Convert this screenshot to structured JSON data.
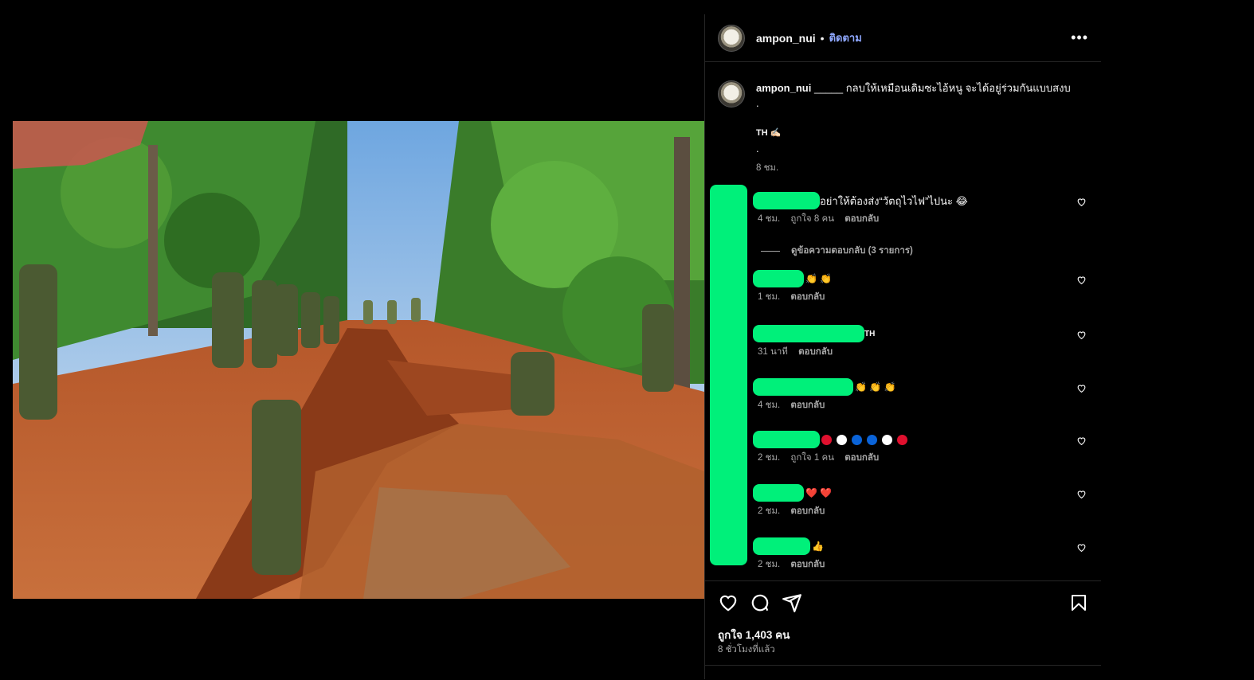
{
  "post": {
    "username": "ampon_nui",
    "follow_label": "ติดตาม",
    "caption_username": "ampon_nui",
    "caption_text": "_____ กลบให้เหมือนเดิมซะไอ้หนู จะได้อยู่ร่วมกันแบบสงบ",
    "caption_line2": ".",
    "caption_line3": "TH ✍🏻",
    "caption_line4": ".",
    "caption_time": "8 ชม."
  },
  "comments": [
    {
      "text": "อย่าให้ต้องส่ง“วัตถุไวไฟ”ไปนะ 😂",
      "time": "4 ชม.",
      "likes": "ถูกใจ 8 คน",
      "reply": "ตอบกลับ"
    },
    {
      "text": "👏 👏",
      "time": "1 ชม.",
      "likes": "",
      "reply": "ตอบกลับ"
    },
    {
      "text": "TH",
      "time": "31 นาที",
      "likes": "",
      "reply": "ตอบกลับ"
    },
    {
      "text": "👏 👏 👏",
      "time": "4 ชม.",
      "likes": "",
      "reply": "ตอบกลับ"
    },
    {
      "text": "",
      "time": "2 ชม.",
      "likes": "ถูกใจ 1 คน",
      "reply": "ตอบกลับ"
    },
    {
      "text": "❤️ ❤️",
      "time": "2 ชม.",
      "likes": "",
      "reply": "ตอบกลับ"
    },
    {
      "text": "👍",
      "time": "2 ชม.",
      "likes": "",
      "reply": "ตอบกลับ"
    }
  ],
  "view_replies": "ดูข้อความตอบกลับ (3 รายการ)",
  "likes_total": "ถูกใจ 1,403 คน",
  "posted_ago": "8 ชั่วโมงที่แล้ว",
  "colors": {
    "redaction": "#00f07a",
    "follow": "#8fa8ff",
    "red": "#e0102e",
    "blue": "#0a63d8",
    "white": "#ffffff"
  },
  "icons": [
    "heart-icon",
    "comment-icon",
    "share-icon",
    "bookmark-icon",
    "more-icon"
  ]
}
